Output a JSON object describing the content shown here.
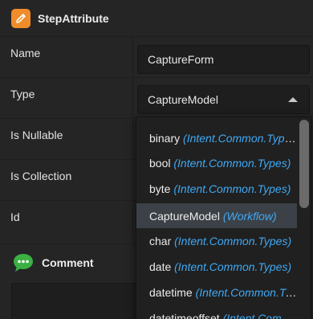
{
  "header": {
    "title": "StepAttribute",
    "icon": "pencil-icon",
    "icon_color": "#f08c2a"
  },
  "properties": [
    {
      "label": "Name",
      "value": "CaptureForm"
    },
    {
      "label": "Type",
      "value": "CaptureModel"
    },
    {
      "label": "Is Nullable"
    },
    {
      "label": "Is Collection"
    },
    {
      "label": "Id"
    }
  ],
  "dropdown": {
    "options": [
      {
        "name": "binary",
        "namespace": "(Intent.Common.Types)",
        "selected": false
      },
      {
        "name": "bool",
        "namespace": "(Intent.Common.Types)",
        "selected": false
      },
      {
        "name": "byte",
        "namespace": "(Intent.Common.Types)",
        "selected": false
      },
      {
        "name": "CaptureModel",
        "namespace": "(Workflow)",
        "selected": true
      },
      {
        "name": "char",
        "namespace": "(Intent.Common.Types)",
        "selected": false
      },
      {
        "name": "date",
        "namespace": "(Intent.Common.Types)",
        "selected": false
      },
      {
        "name": "datetime",
        "namespace": "(Intent.Common.Types)",
        "selected": false
      },
      {
        "name": "datetimeoffset",
        "namespace": "(Intent.Common.Types)",
        "selected": false
      }
    ]
  },
  "comment": {
    "title": "Comment",
    "icon": "speech-bubble-icon",
    "icon_color": "#3cb043"
  }
}
